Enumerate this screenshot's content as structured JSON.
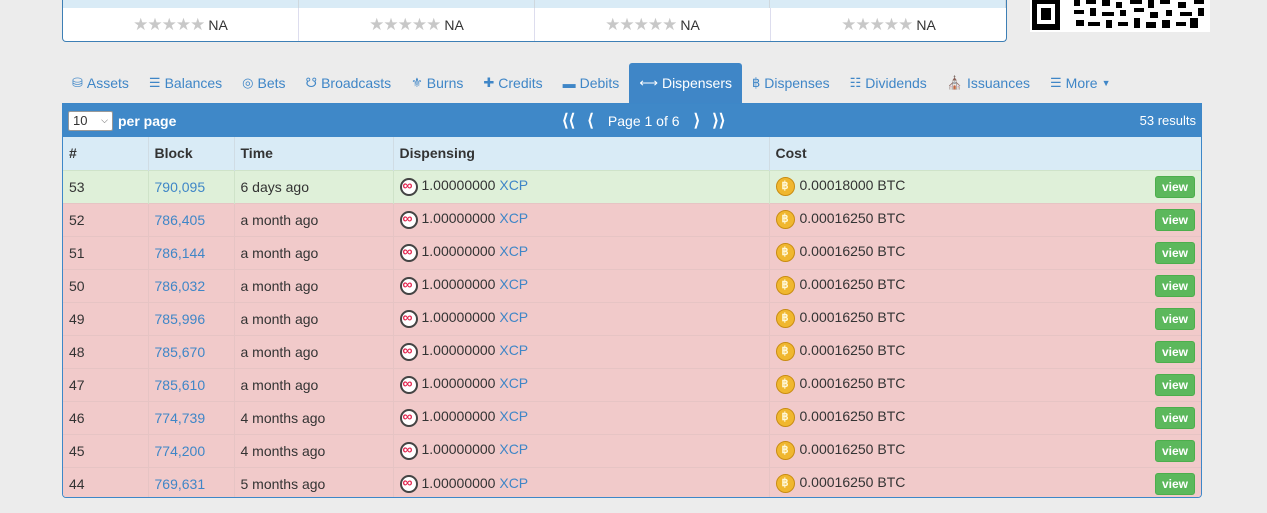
{
  "top_ratings": [
    {
      "value": "NA"
    },
    {
      "value": "NA"
    },
    {
      "value": "NA"
    },
    {
      "value": "NA"
    }
  ],
  "tabs": [
    {
      "label": "Assets",
      "icon": "database-icon"
    },
    {
      "label": "Balances",
      "icon": "list-icon"
    },
    {
      "label": "Bets",
      "icon": "target-icon"
    },
    {
      "label": "Broadcasts",
      "icon": "megaphone-icon"
    },
    {
      "label": "Burns",
      "icon": "fire-icon"
    },
    {
      "label": "Credits",
      "icon": "plus-icon"
    },
    {
      "label": "Debits",
      "icon": "minus-icon"
    },
    {
      "label": "Dispensers",
      "icon": "arrows-h-icon",
      "active": true
    },
    {
      "label": "Dispenses",
      "icon": "bitcoin-icon"
    },
    {
      "label": "Dividends",
      "icon": "sitemap-icon"
    },
    {
      "label": "Issuances",
      "icon": "bank-icon"
    },
    {
      "label": "More",
      "icon": "list-alt-icon"
    }
  ],
  "toolbar": {
    "per_page_value": "10",
    "per_page_label": "per page",
    "page_label": "Page 1 of 6",
    "results": "53 results"
  },
  "table": {
    "headers": [
      "#",
      "Block",
      "Time",
      "Dispensing",
      "Cost"
    ],
    "rows": [
      {
        "num": "53",
        "block": "790,095",
        "time": "6 days ago",
        "amount": "1.00000000",
        "asset": "XCP",
        "cost": "0.00018000 BTC",
        "status": "green"
      },
      {
        "num": "52",
        "block": "786,405",
        "time": "a month ago",
        "amount": "1.00000000",
        "asset": "XCP",
        "cost": "0.00016250 BTC",
        "status": "red"
      },
      {
        "num": "51",
        "block": "786,144",
        "time": "a month ago",
        "amount": "1.00000000",
        "asset": "XCP",
        "cost": "0.00016250 BTC",
        "status": "red"
      },
      {
        "num": "50",
        "block": "786,032",
        "time": "a month ago",
        "amount": "1.00000000",
        "asset": "XCP",
        "cost": "0.00016250 BTC",
        "status": "red"
      },
      {
        "num": "49",
        "block": "785,996",
        "time": "a month ago",
        "amount": "1.00000000",
        "asset": "XCP",
        "cost": "0.00016250 BTC",
        "status": "red"
      },
      {
        "num": "48",
        "block": "785,670",
        "time": "a month ago",
        "amount": "1.00000000",
        "asset": "XCP",
        "cost": "0.00016250 BTC",
        "status": "red"
      },
      {
        "num": "47",
        "block": "785,610",
        "time": "a month ago",
        "amount": "1.00000000",
        "asset": "XCP",
        "cost": "0.00016250 BTC",
        "status": "red"
      },
      {
        "num": "46",
        "block": "774,739",
        "time": "4 months ago",
        "amount": "1.00000000",
        "asset": "XCP",
        "cost": "0.00016250 BTC",
        "status": "red"
      },
      {
        "num": "45",
        "block": "774,200",
        "time": "4 months ago",
        "amount": "1.00000000",
        "asset": "XCP",
        "cost": "0.00016250 BTC",
        "status": "red"
      },
      {
        "num": "44",
        "block": "769,631",
        "time": "5 months ago",
        "amount": "1.00000000",
        "asset": "XCP",
        "cost": "0.00016250 BTC",
        "status": "red"
      }
    ],
    "view_label": "view"
  },
  "colors": {
    "accent": "#3f88c8",
    "row_open": "#dff0d9",
    "row_closed": "#f1caca",
    "view_button": "#5cb85c"
  }
}
